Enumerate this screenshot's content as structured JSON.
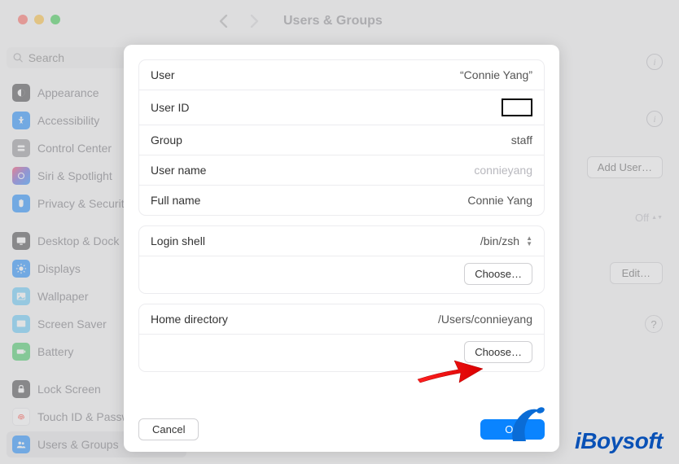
{
  "window": {
    "title": "Users & Groups"
  },
  "search": {
    "placeholder": "Search"
  },
  "sidebar": {
    "groups": [
      {
        "items": [
          {
            "label": "Appearance",
            "icon": "appearance",
            "color": "c-dark"
          },
          {
            "label": "Accessibility",
            "icon": "accessibility",
            "color": "c-blue"
          },
          {
            "label": "Control Center",
            "icon": "control-center",
            "color": "c-gray"
          },
          {
            "label": "Siri & Spotlight",
            "icon": "siri",
            "color": "c-purple"
          },
          {
            "label": "Privacy & Security",
            "icon": "privacy",
            "color": "c-lblue"
          }
        ]
      },
      {
        "items": [
          {
            "label": "Desktop & Dock",
            "icon": "desktop",
            "color": "c-dark"
          },
          {
            "label": "Displays",
            "icon": "displays",
            "color": "c-lblue"
          },
          {
            "label": "Wallpaper",
            "icon": "wallpaper",
            "color": "c-cyan"
          },
          {
            "label": "Screen Saver",
            "icon": "screensaver",
            "color": "c-cyan"
          },
          {
            "label": "Battery",
            "icon": "battery",
            "color": "c-green"
          }
        ]
      },
      {
        "items": [
          {
            "label": "Lock Screen",
            "icon": "lock",
            "color": "c-dark"
          },
          {
            "label": "Touch ID & Password",
            "icon": "touchid",
            "color": "c-red"
          },
          {
            "label": "Users & Groups",
            "icon": "users",
            "color": "c-lblue",
            "active": true
          }
        ]
      }
    ]
  },
  "background_content": {
    "add_user": "Add User…",
    "off": "Off",
    "edit": "Edit…"
  },
  "modal": {
    "user_label": "User",
    "user_value": "“Connie Yang”",
    "userid_label": "User ID",
    "group_label": "Group",
    "group_value": "staff",
    "username_label": "User name",
    "username_value": "connieyang",
    "fullname_label": "Full name",
    "fullname_value": "Connie Yang",
    "loginshell_label": "Login shell",
    "loginshell_value": "/bin/zsh",
    "choose": "Choose…",
    "homedir_label": "Home directory",
    "homedir_value": "/Users/connieyang",
    "cancel": "Cancel",
    "ok": "OK"
  },
  "watermark": "iBoysoft"
}
